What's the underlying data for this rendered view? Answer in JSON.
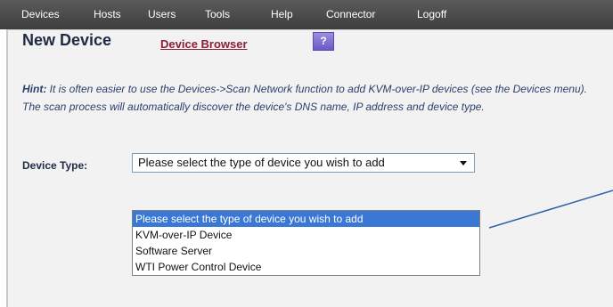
{
  "nav": {
    "items": [
      {
        "label": "Devices"
      },
      {
        "label": "Hosts"
      },
      {
        "label": "Users"
      },
      {
        "label": "Tools"
      },
      {
        "label": "Help"
      },
      {
        "label": "Connector"
      },
      {
        "label": "Logoff"
      }
    ]
  },
  "header": {
    "title": "New Device",
    "browser_link": "Device Browser",
    "help_label": "?"
  },
  "hint": {
    "label": "Hint:",
    "text": " It is often easier to use the Devices->Scan Network function to add KVM-over-IP devices (see the Devices menu). The scan process will automatically discover the device's DNS name, IP address and device type."
  },
  "device_type": {
    "label": "Device Type:",
    "selected": "Please select the type of device you wish to add",
    "options": [
      {
        "label": "Please select the type of device you wish to add"
      },
      {
        "label": "KVM-over-IP Device"
      },
      {
        "label": "Software Server"
      },
      {
        "label": "WTI Power Control Device"
      }
    ]
  },
  "colors": {
    "navbar": "#3d3d3d",
    "page_bg": "#f2f2f2",
    "link": "#8b1f3a",
    "highlight": "#3a78d6",
    "callout": "#2d5fa8"
  }
}
